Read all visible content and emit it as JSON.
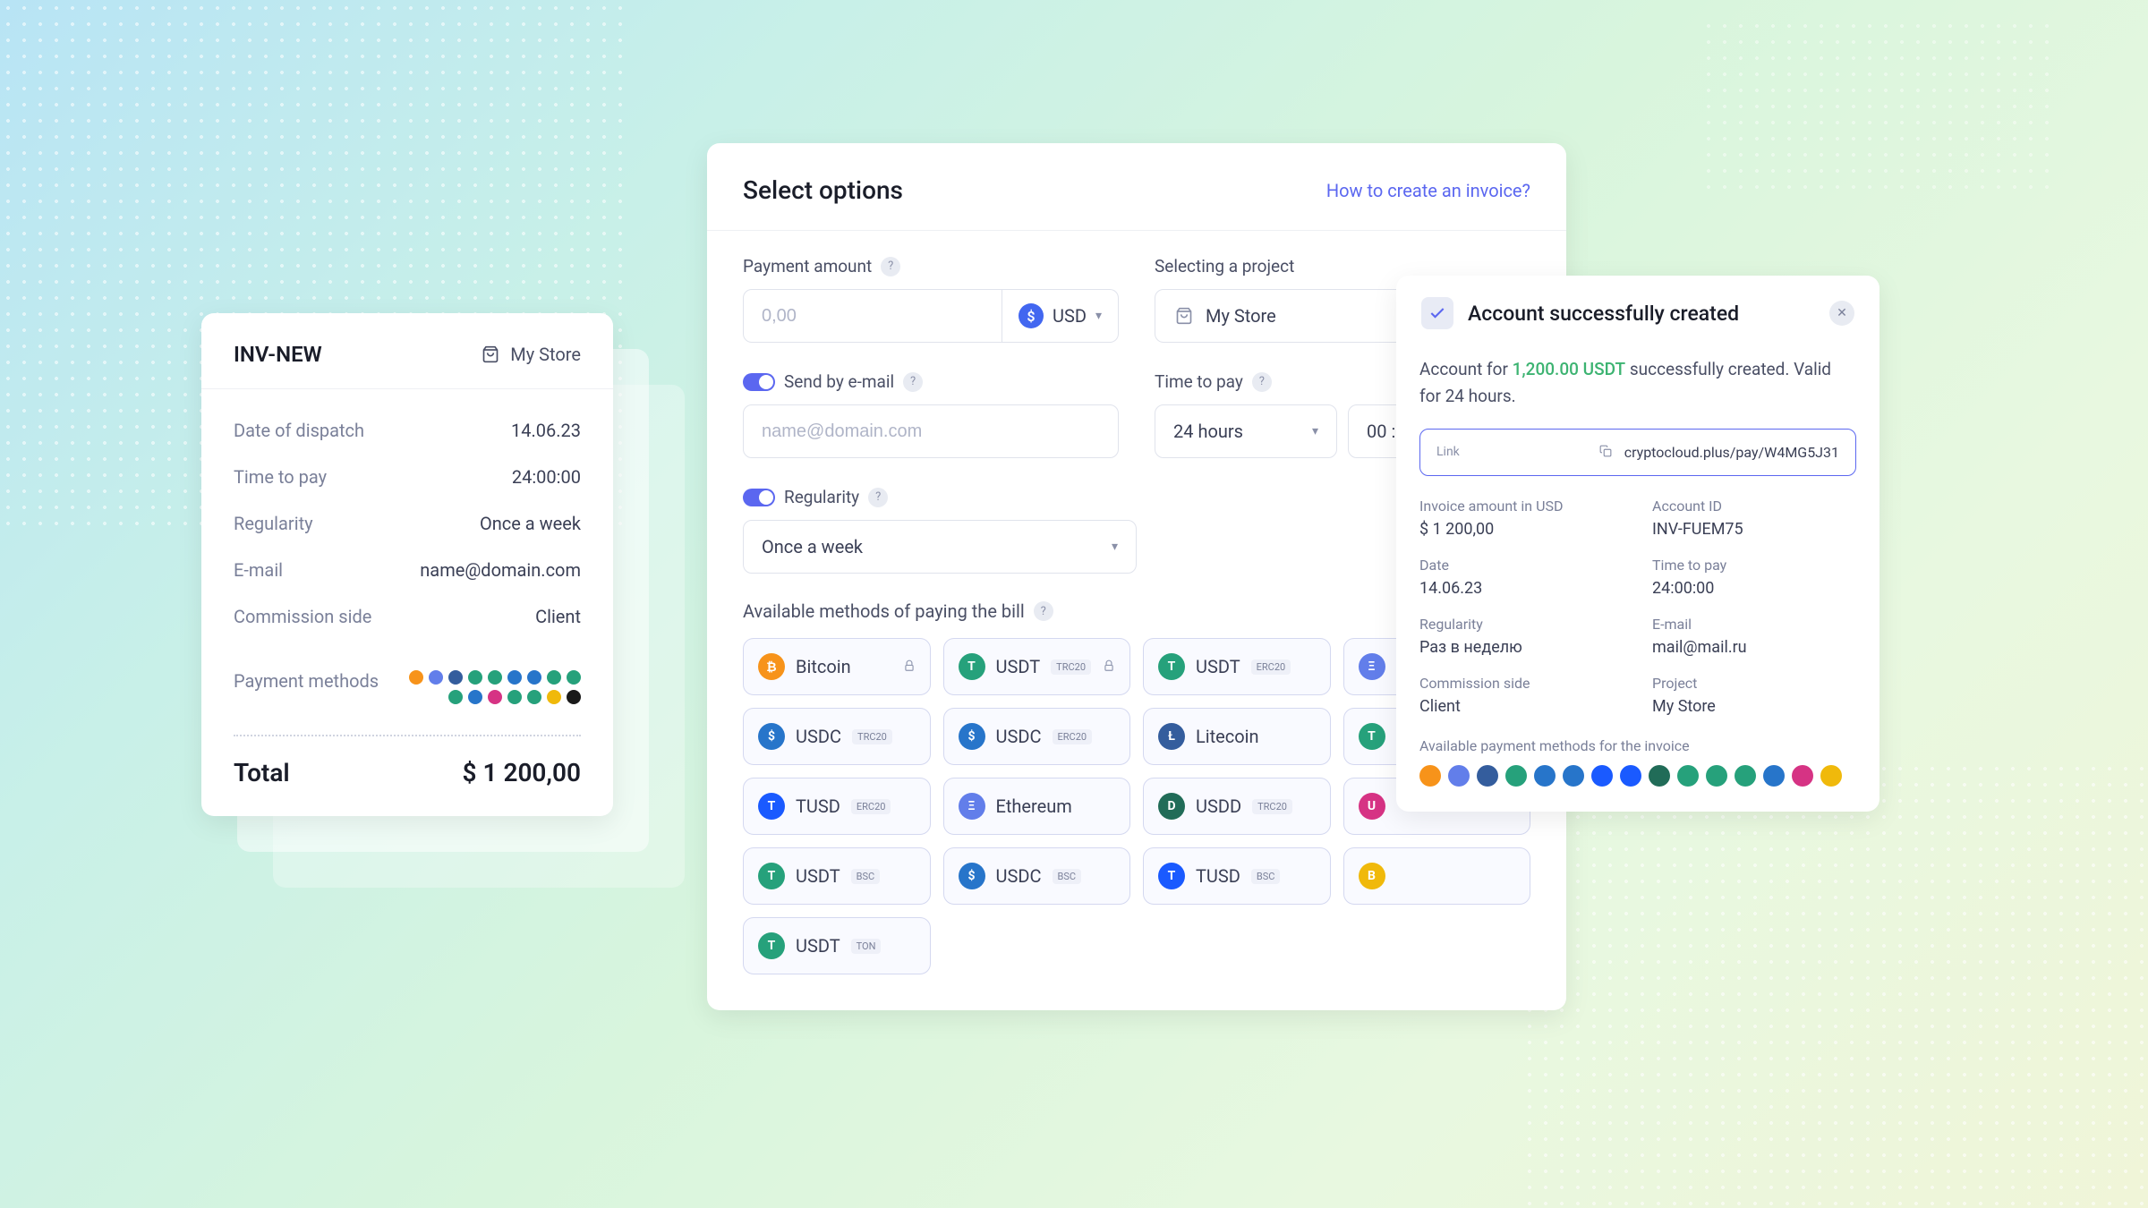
{
  "left": {
    "title": "INV-NEW",
    "store": "My Store",
    "rows": [
      {
        "label": "Date of dispatch",
        "value": "14.06.23"
      },
      {
        "label": "Time to pay",
        "value": "24:00:00"
      },
      {
        "label": "Regularity",
        "value": "Once a week"
      },
      {
        "label": "E-mail",
        "value": "name@domain.com"
      },
      {
        "label": "Commission side",
        "value": "Client"
      }
    ],
    "payment_methods_label": "Payment methods",
    "total_label": "Total",
    "total_value": "$ 1 200,00",
    "method_colors": [
      "#f7931a",
      "#627eea",
      "#345d9d",
      "#26a17b",
      "#26a17b",
      "#2775ca",
      "#2775ca",
      "#26a17b",
      "#26a17b",
      "#26a17b",
      "#2775ca",
      "#d63384",
      "#26a17b",
      "#26a17b",
      "#f0b90b",
      "#1a1a1a"
    ]
  },
  "main": {
    "title": "Select options",
    "help_link": "How to create an invoice?",
    "payment_amount_label": "Payment amount",
    "payment_amount_placeholder": "0,00",
    "currency": "USD",
    "project_label": "Selecting a project",
    "project_value": "My Store",
    "send_email_label": "Send by e-mail",
    "email_placeholder": "name@domain.com",
    "time_to_pay_label": "Time to pay",
    "time_value": "24 hours",
    "time_minutes": "00 :",
    "regularity_label": "Regularity",
    "regularity_value": "Once a week",
    "methods_label": "Available methods of paying the bill",
    "methods": [
      {
        "name": "Bitcoin",
        "tag": "",
        "lock": true,
        "color": "#f7931a",
        "glyph": "₿"
      },
      {
        "name": "USDT",
        "tag": "TRC20",
        "lock": true,
        "color": "#26a17b",
        "glyph": "T"
      },
      {
        "name": "USDT",
        "tag": "ERC20",
        "color": "#26a17b",
        "glyph": "T"
      },
      {
        "name": "",
        "tag": "",
        "color": "#627eea",
        "glyph": "Ξ",
        "partial": true
      },
      {
        "name": "USDC",
        "tag": "TRC20",
        "color": "#2775ca",
        "glyph": "$"
      },
      {
        "name": "USDC",
        "tag": "ERC20",
        "color": "#2775ca",
        "glyph": "$"
      },
      {
        "name": "Litecoin",
        "tag": "",
        "color": "#345d9d",
        "glyph": "Ł"
      },
      {
        "name": "",
        "tag": "",
        "color": "#26a17b",
        "glyph": "T",
        "partial": true
      },
      {
        "name": "TUSD",
        "tag": "ERC20",
        "color": "#1a5aff",
        "glyph": "T"
      },
      {
        "name": "Ethereum",
        "tag": "",
        "color": "#627eea",
        "glyph": "Ξ"
      },
      {
        "name": "USDD",
        "tag": "TRC20",
        "color": "#216c58",
        "glyph": "D"
      },
      {
        "name": "",
        "tag": "",
        "color": "#d63384",
        "glyph": "U",
        "partial": true
      },
      {
        "name": "USDT",
        "tag": "BSC",
        "color": "#26a17b",
        "glyph": "T"
      },
      {
        "name": "USDC",
        "tag": "BSC",
        "color": "#2775ca",
        "glyph": "$"
      },
      {
        "name": "TUSD",
        "tag": "BSC",
        "color": "#1a5aff",
        "glyph": "T"
      },
      {
        "name": "",
        "tag": "",
        "color": "#f0b90b",
        "glyph": "B",
        "partial": true
      },
      {
        "name": "USDT",
        "tag": "TON",
        "color": "#26a17b",
        "glyph": "T"
      }
    ]
  },
  "right": {
    "title": "Account successfully created",
    "msg_pre": "Account for ",
    "msg_amount": "1,200.00 USDT",
    "msg_post": " successfully created. Valid for 24 hours.",
    "link_label": "Link",
    "link_value": "cryptocloud.plus/pay/W4MG5J31",
    "info": [
      {
        "label": "Invoice amount in USD",
        "value": "$ 1 200,00"
      },
      {
        "label": "Account ID",
        "value": "INV-FUEM75"
      },
      {
        "label": "Date",
        "value": "14.06.23"
      },
      {
        "label": "Time to pay",
        "value": "24:00:00"
      },
      {
        "label": "Regularity",
        "value": "Раз в неделю"
      },
      {
        "label": "E-mail",
        "value": "mail@mail.ru"
      },
      {
        "label": "Commission side",
        "value": "Client"
      },
      {
        "label": "Project",
        "value": "My Store"
      }
    ],
    "methods_label": "Available payment methods for the invoice",
    "method_colors": [
      "#f7931a",
      "#627eea",
      "#345d9d",
      "#26a17b",
      "#2775ca",
      "#2775ca",
      "#1a5aff",
      "#1a5aff",
      "#216c58",
      "#26a17b",
      "#26a17b",
      "#26a17b",
      "#2775ca",
      "#d63384",
      "#f0b90b"
    ]
  }
}
